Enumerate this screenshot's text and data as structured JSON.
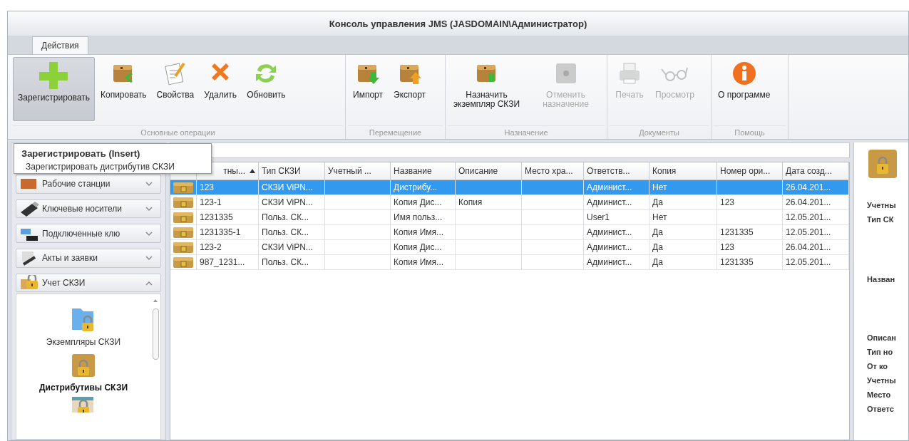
{
  "window": {
    "title": "Консоль управления JMS (JASDOMAIN\\Администратор)"
  },
  "tabs": [
    {
      "label": "Действия",
      "selected": true
    }
  ],
  "ribbon": {
    "groups": [
      {
        "label": "Основные операции",
        "buttons": [
          {
            "label": "Зарегистрировать",
            "kind": "plus",
            "highlighted": true,
            "disabled": false
          },
          {
            "label": "Копировать",
            "kind": "box-copy",
            "highlighted": false,
            "disabled": false
          },
          {
            "label": "Свойства",
            "kind": "notepad",
            "highlighted": false,
            "disabled": false
          },
          {
            "label": "Удалить",
            "kind": "cross",
            "highlighted": false,
            "disabled": false
          },
          {
            "label": "Обновить",
            "kind": "refresh",
            "highlighted": false,
            "disabled": false
          }
        ]
      },
      {
        "label": "Перемещение",
        "buttons": [
          {
            "label": "Импорт",
            "kind": "box-down",
            "highlighted": false,
            "disabled": false
          },
          {
            "label": "Экспорт",
            "kind": "box-up",
            "highlighted": false,
            "disabled": false
          }
        ]
      },
      {
        "label": "Назначение",
        "buttons": [
          {
            "label": "Назначить экземпляр СКЗИ",
            "kind": "box-assign",
            "highlighted": false,
            "disabled": false
          },
          {
            "label": "Отменить назначение",
            "kind": "safe",
            "highlighted": false,
            "disabled": true
          }
        ]
      },
      {
        "label": "Документы",
        "buttons": [
          {
            "label": "Печать",
            "kind": "printer",
            "highlighted": false,
            "disabled": true
          },
          {
            "label": "Просмотр",
            "kind": "glasses",
            "highlighted": false,
            "disabled": true
          }
        ]
      },
      {
        "label": "Помощь",
        "buttons": [
          {
            "label": "О программе",
            "kind": "info",
            "highlighted": false,
            "disabled": false
          }
        ]
      }
    ]
  },
  "tooltip": {
    "title": "Зарегистрировать (Insert)",
    "text": "Зарегистрировать дистрибутив СКЗИ"
  },
  "sidebar": {
    "items": [
      {
        "label": "Рабочие станции",
        "kind": "workstation",
        "expanded": false
      },
      {
        "label": "Ключевые носители",
        "kind": "usb",
        "expanded": false
      },
      {
        "label": "Подключенные клю",
        "kind": "network",
        "expanded": false
      },
      {
        "label": "Акты и заявки",
        "kind": "acts",
        "expanded": false
      },
      {
        "label": "Учет СКЗИ",
        "kind": "lock",
        "expanded": true,
        "children": [
          {
            "label": "Экземпляры СКЗИ",
            "kind": "folder-lock",
            "selected": false
          },
          {
            "label": "Дистрибутивы СКЗИ",
            "kind": "box-lock",
            "selected": true
          }
        ]
      }
    ]
  },
  "table": {
    "columns": [
      {
        "label": "тны...",
        "sorted": true
      },
      {
        "label": "Тип СКЗИ"
      },
      {
        "label": "Учетный ..."
      },
      {
        "label": "Название"
      },
      {
        "label": "Описание"
      },
      {
        "label": "Место хра..."
      },
      {
        "label": "Ответств..."
      },
      {
        "label": "Копия"
      },
      {
        "label": "Номер ори..."
      },
      {
        "label": "Дата созд..."
      }
    ],
    "rows": [
      {
        "selected": true,
        "cells": [
          "123",
          "СКЗИ ViPN...",
          "",
          "Дистрибу...",
          "",
          "",
          "Админист...",
          "Нет",
          "",
          "26.04.201..."
        ]
      },
      {
        "selected": false,
        "cells": [
          "123-1",
          "СКЗИ ViPN...",
          "",
          "Копия Дис...",
          "Копия",
          "",
          "Админист...",
          "Да",
          "123",
          "26.04.201..."
        ]
      },
      {
        "selected": false,
        "cells": [
          "1231335",
          "Польз. СК...",
          "",
          "Имя польз...",
          "",
          "",
          "User1",
          "Нет",
          "",
          "12.05.201..."
        ]
      },
      {
        "selected": false,
        "cells": [
          "1231335-1",
          "Польз. СК...",
          "",
          "Копия Имя...",
          "",
          "",
          "Админист...",
          "Да",
          "1231335",
          "12.05.201..."
        ]
      },
      {
        "selected": false,
        "cells": [
          "123-2",
          "СКЗИ ViPN...",
          "",
          "Копия Дис...",
          "",
          "",
          "Админист...",
          "Да",
          "123",
          "26.04.201..."
        ]
      },
      {
        "selected": false,
        "cells": [
          "987_1231...",
          "Польз. СК...",
          "",
          "Копия Имя...",
          "",
          "",
          "Админист...",
          "Да",
          "1231335",
          "12.05.201..."
        ]
      }
    ]
  },
  "details": {
    "labels": [
      "Учетны",
      "Тип СК",
      "Назван",
      "Описан",
      "Тип но",
      "От ко",
      "Учетны",
      "Место",
      "Ответс"
    ]
  }
}
